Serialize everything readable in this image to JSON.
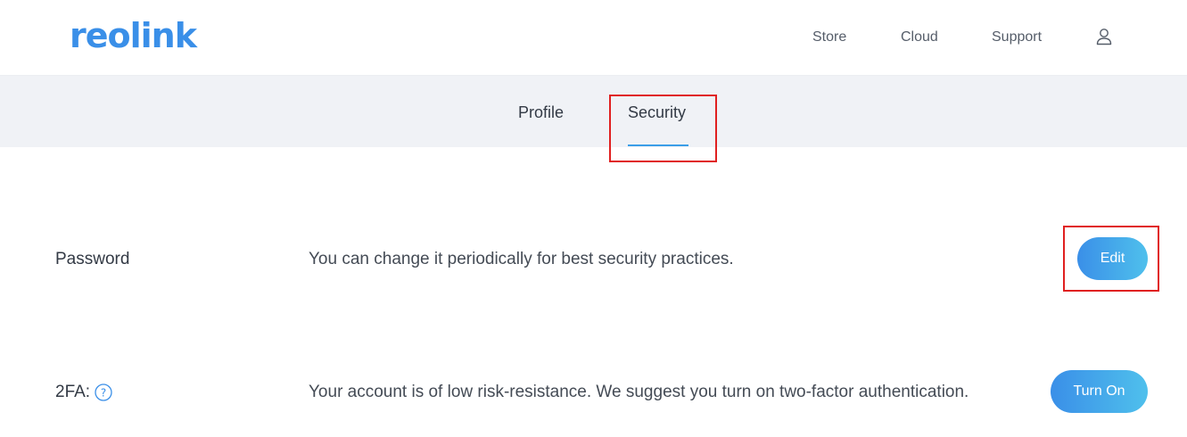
{
  "header": {
    "logo_text": "reolink",
    "nav": {
      "store": "Store",
      "cloud": "Cloud",
      "support": "Support"
    },
    "user_icon": "user-icon"
  },
  "tabs": {
    "profile": "Profile",
    "security": "Security",
    "active": "Security"
  },
  "security": {
    "password": {
      "label": "Password",
      "description": "You can change it periodically for best security practices.",
      "button": "Edit"
    },
    "twofa": {
      "label": "2FA:",
      "help_icon": "question-circle-icon",
      "description": "Your account is of low risk-resistance. We suggest you turn on two-factor authentication.",
      "button": "Turn On"
    }
  },
  "colors": {
    "accent": "#3a8fe8",
    "highlight": "#e02020",
    "tabbar_bg": "#f0f2f6"
  }
}
